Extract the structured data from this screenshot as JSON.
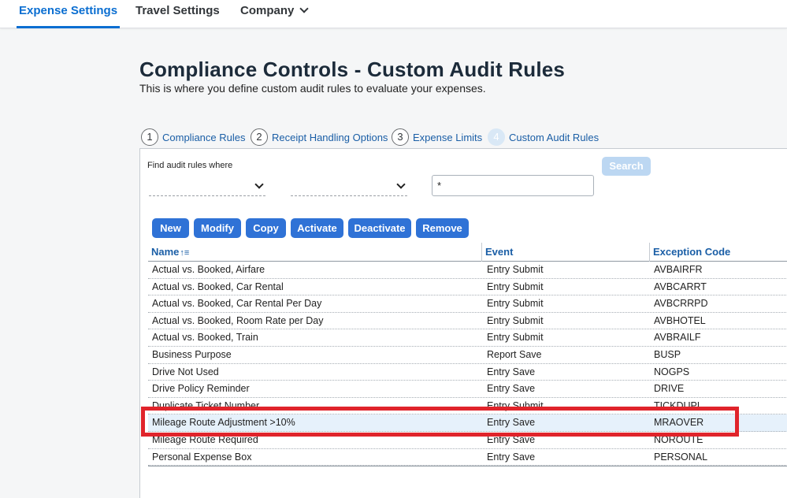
{
  "nav": {
    "tabs": [
      {
        "label": "Expense Settings",
        "active": true
      },
      {
        "label": "Travel Settings",
        "active": false
      },
      {
        "label": "Company",
        "active": false
      }
    ]
  },
  "page": {
    "title": "Compliance Controls - Custom Audit Rules",
    "subtitle": "This is where you define custom audit rules to evaluate your expenses."
  },
  "steps": [
    {
      "number": "1",
      "label": "Compliance Rules",
      "current": false
    },
    {
      "number": "2",
      "label": "Receipt Handling Options",
      "current": false
    },
    {
      "number": "3",
      "label": "Expense Limits",
      "current": false
    },
    {
      "number": "4",
      "label": "Custom Audit Rules",
      "current": true
    }
  ],
  "filter": {
    "label": "Find audit rules where",
    "field_value": "",
    "operator_value": "",
    "search_value": "*",
    "search_button": "Search"
  },
  "toolbar": {
    "new": "New",
    "modify": "Modify",
    "copy": "Copy",
    "activate": "Activate",
    "deactivate": "Deactivate",
    "remove": "Remove"
  },
  "table": {
    "columns": [
      "Name",
      "Event",
      "Exception Code"
    ],
    "sort_icon": "↑≡",
    "rows": [
      {
        "name": "Actual vs. Booked, Airfare",
        "event": "Entry Submit",
        "code": "AVBAIRFR"
      },
      {
        "name": "Actual vs. Booked, Car Rental",
        "event": "Entry Submit",
        "code": "AVBCARRT"
      },
      {
        "name": "Actual vs. Booked, Car Rental Per Day",
        "event": "Entry Submit",
        "code": "AVBCRRPD"
      },
      {
        "name": "Actual vs. Booked, Room Rate per Day",
        "event": "Entry Submit",
        "code": "AVBHOTEL"
      },
      {
        "name": "Actual vs. Booked, Train",
        "event": "Entry Submit",
        "code": "AVBRAILF"
      },
      {
        "name": "Business Purpose",
        "event": "Report Save",
        "code": "BUSP"
      },
      {
        "name": "Drive Not Used",
        "event": "Entry Save",
        "code": "NOGPS"
      },
      {
        "name": "Drive Policy Reminder",
        "event": "Entry Save",
        "code": "DRIVE"
      },
      {
        "name": "Duplicate Ticket Number",
        "event": "Entry Submit",
        "code": "TICKDUPL"
      },
      {
        "name": "Mileage Route Adjustment >10%",
        "event": "Entry Save",
        "code": "MRAOVER",
        "selected": true
      },
      {
        "name": "Mileage Route Required",
        "event": "Entry Save",
        "code": "NOROUTE"
      },
      {
        "name": "Personal Expense Box",
        "event": "Entry Save",
        "code": "PERSONAL"
      }
    ]
  },
  "colors": {
    "accent": "#0a6ed1",
    "button": "#2f72d6",
    "highlight": "#e0242b",
    "selected_row": "#e6f1fb"
  }
}
